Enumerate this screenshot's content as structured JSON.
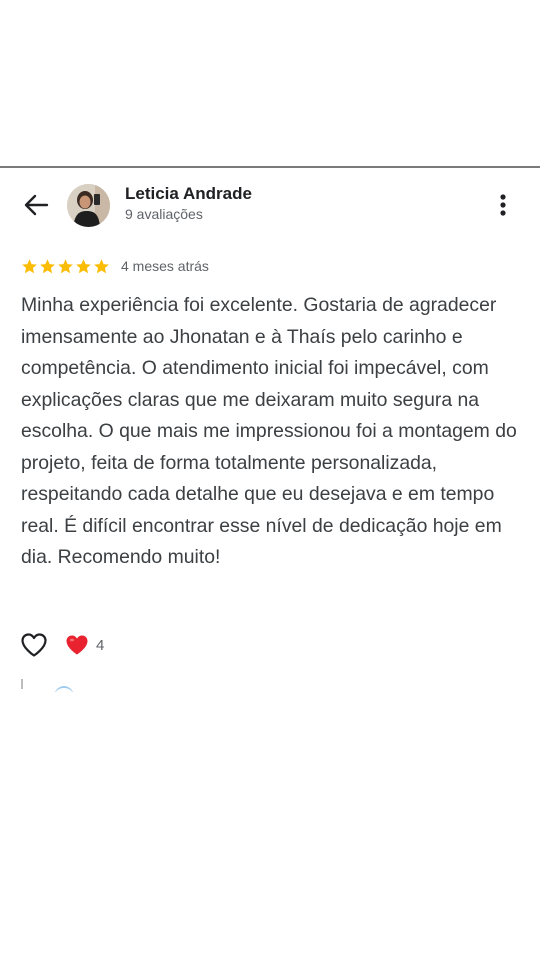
{
  "colors": {
    "divider": "#7a7a7a",
    "star": "#fbbc04",
    "heart_reaction": "#e8232f",
    "secondary_text": "#5f6368",
    "body_text": "#3c4043"
  },
  "header": {
    "back_icon": "arrow-left-icon",
    "author_name": "Leticia Andrade",
    "author_meta": "9 avaliações",
    "menu_icon": "more-vertical-icon"
  },
  "review": {
    "rating": 5,
    "rating_max": 5,
    "date": "4 meses atrás",
    "text": "Minha experiência foi excelente. Gostaria de agradecer imensamente ao Jhonatan e à Thaís pelo carinho e competência. O atendimento inicial foi impecável, com explicações claras que me deixaram muito segura na escolha. O que mais me impressionou foi a montagem do projeto, feita de forma totalmente personalizada, respeitando cada detalhe que eu desejava e em tempo real. É difícil encontrar esse nível de dedicação hoje em dia. Recomendo muito!"
  },
  "actions": {
    "like_icon": "heart-outline-icon",
    "reaction_icon": "heart-filled-icon",
    "reaction_count": "4"
  }
}
